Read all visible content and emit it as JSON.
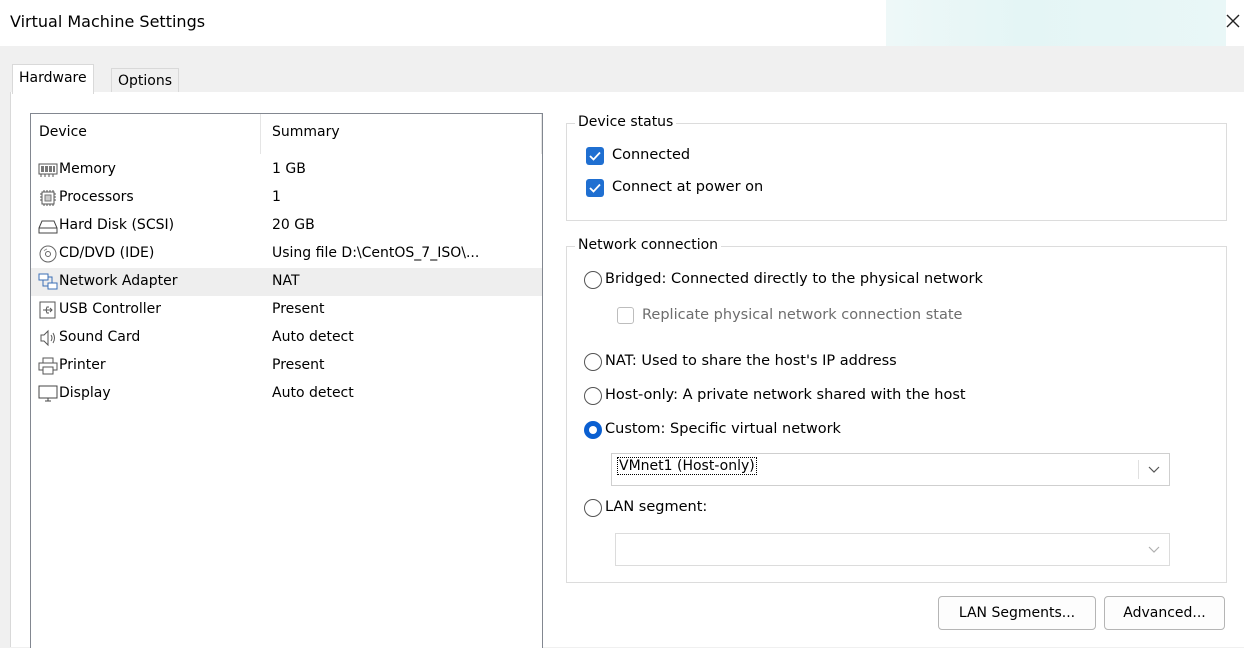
{
  "window": {
    "title": "Virtual Machine Settings"
  },
  "tabs": [
    {
      "label": "Hardware",
      "active": true
    },
    {
      "label": "Options",
      "active": false
    }
  ],
  "device_list": {
    "headers": {
      "device": "Device",
      "summary": "Summary"
    },
    "rows": [
      {
        "name": "Memory",
        "summary": "1 GB",
        "icon": "memory-icon"
      },
      {
        "name": "Processors",
        "summary": "1",
        "icon": "processor-icon"
      },
      {
        "name": "Hard Disk (SCSI)",
        "summary": "20 GB",
        "icon": "hard-disk-icon"
      },
      {
        "name": "CD/DVD (IDE)",
        "summary": "Using file D:\\CentOS_7_ISO\\...",
        "icon": "cd-dvd-icon"
      },
      {
        "name": "Network Adapter",
        "summary": "NAT",
        "icon": "network-adapter-icon",
        "selected": true
      },
      {
        "name": "USB Controller",
        "summary": "Present",
        "icon": "usb-icon"
      },
      {
        "name": "Sound Card",
        "summary": "Auto detect",
        "icon": "speaker-icon"
      },
      {
        "name": "Printer",
        "summary": "Present",
        "icon": "printer-icon"
      },
      {
        "name": "Display",
        "summary": "Auto detect",
        "icon": "display-icon"
      }
    ]
  },
  "device_status": {
    "label": "Device status",
    "connected": {
      "label": "Connected",
      "checked": true
    },
    "connect_at_power_on": {
      "label": "Connect at power on",
      "checked": true
    }
  },
  "network_connection": {
    "label": "Network connection",
    "bridged": {
      "label": "Bridged: Connected directly to the physical network",
      "selected": false
    },
    "replicate": {
      "label": "Replicate physical network connection state",
      "checked": false,
      "enabled": false
    },
    "nat": {
      "label": "NAT: Used to share the host's IP address",
      "selected": false
    },
    "host_only": {
      "label": "Host-only: A private network shared with the host",
      "selected": false
    },
    "custom": {
      "label": "Custom: Specific virtual network",
      "selected": true
    },
    "custom_network": {
      "value": "VMnet1 (Host-only)"
    },
    "lan_segment": {
      "label": "LAN segment:",
      "selected": false
    },
    "lan_segment_value": {
      "value": ""
    }
  },
  "buttons": {
    "lan_segments": "LAN Segments...",
    "advanced": "Advanced..."
  },
  "colors": {
    "accent": "#1f6fd1",
    "selected_row": "#eeeeee"
  }
}
